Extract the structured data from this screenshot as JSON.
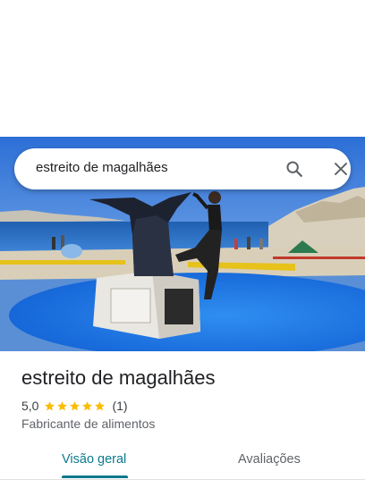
{
  "search": {
    "query": "estreito de magalhães",
    "search_icon": "search-icon",
    "clear_icon": "close-icon"
  },
  "place": {
    "title": "estreito de magalhães",
    "rating": "5,0",
    "stars": 5,
    "review_count": "(1)",
    "category": "Fabricante de alimentos"
  },
  "tabs": [
    {
      "label": "Visão geral",
      "active": true
    },
    {
      "label": "Avaliações",
      "active": false
    }
  ],
  "colors": {
    "accent": "#0b7a8c",
    "star": "#fbbc04"
  }
}
